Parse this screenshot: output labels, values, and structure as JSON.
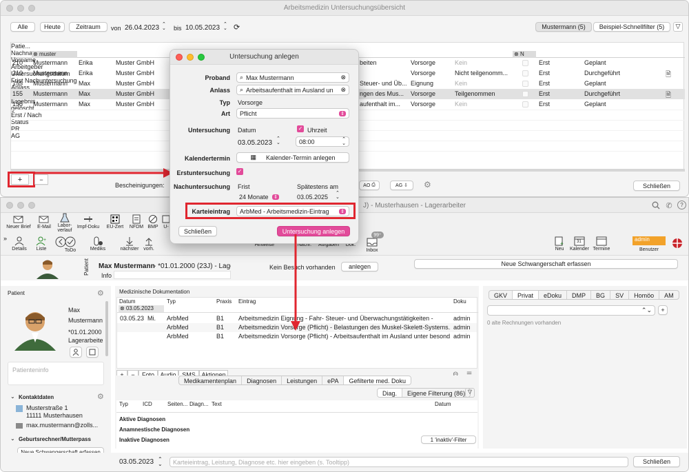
{
  "top_window": {
    "title": "Arbeitsmedizin Untersuchungsübersicht",
    "buttons": {
      "alle": "Alle",
      "heute": "Heute",
      "zeitraum": "Zeitraum",
      "von": "von",
      "von_date": "26.04.2023",
      "bis": "bis",
      "bis_date": "10.05.2023"
    },
    "filters": {
      "mustermann": "Mustermann (5)",
      "schnellfilter": "Beispiel-Schnellfilter (5)"
    },
    "columns": [
      "Patie...",
      "Nachname",
      "Vorname",
      "Arbeitgeber",
      "Untersuchungsdatum",
      "Frist Nachuntersuchung",
      "Anlass",
      "Typ",
      "Ergebnis",
      "gelöscht",
      "Erst / Nach",
      "Status",
      "PR",
      "AG"
    ],
    "filter_values": {
      "nachname": "muster",
      "geloescht": "N"
    },
    "rows": [
      {
        "id": "210",
        "nach": "Mustermann",
        "vor": "Erika",
        "ag": "Muster GmbH",
        "anlass": "beiten",
        "typ": "Vorsorge",
        "erg": "Kein",
        "en": "Erst",
        "status": "Geplant"
      },
      {
        "id": "210",
        "nach": "Mustermann",
        "vor": "Erika",
        "ag": "Muster GmbH",
        "anlass": "",
        "typ": "Vorsorge",
        "erg": "Nicht teilgenomm...",
        "en": "Erst",
        "status": "Durchgeführt"
      },
      {
        "id": "155",
        "nach": "Mustermann",
        "vor": "Max",
        "ag": "Muster GmbH",
        "anlass": "Steuer- und Üb...",
        "typ": "Eignung",
        "erg": "Kein",
        "en": "Erst",
        "status": "Geplant"
      },
      {
        "id": "155",
        "nach": "Mustermann",
        "vor": "Max",
        "ag": "Muster GmbH",
        "anlass": "ngen des Mus...",
        "typ": "Vorsorge",
        "erg": "Teilgenommen",
        "en": "Erst",
        "status": "Durchgeführt"
      },
      {
        "id": "155",
        "nach": "Mustermann",
        "vor": "Max",
        "ag": "Muster GmbH",
        "anlass": "aufenthalt im...",
        "typ": "Vorsorge",
        "erg": "Kein",
        "en": "Erst",
        "status": "Geplant"
      }
    ],
    "bottom": {
      "plus": "+",
      "minus": "−",
      "bescheinigungen": "Bescheinigungen:",
      "ao": "AO",
      "ag": "AG",
      "schliessen": "Schließen"
    }
  },
  "dialog": {
    "title": "Untersuchung anlegen",
    "proband_label": "Proband",
    "proband": "Max Mustermann",
    "anlass_label": "Anlass",
    "anlass": "Arbeitsaufenthalt im Ausland un",
    "typ_label": "Typ",
    "typ": "Vorsorge",
    "art_label": "Art",
    "art": "Pflicht",
    "untersuchung_label": "Untersuchung",
    "datum_label": "Datum",
    "uhrzeit_label": "Uhrzeit",
    "datum": "03.05.2023",
    "uhrzeit": "08:00",
    "kalender_label": "Kalendertermin",
    "kalender_btn": "Kalender-Termin anlegen",
    "erst_label": "Erstuntersuchung",
    "nach_label": "Nachuntersuchung",
    "frist_label": "Frist",
    "spaet_label": "Spätestens am",
    "frist": "24 Monate",
    "spaet": "03.05.2025",
    "kartei_label": "Karteieintrag",
    "kartei": "ArbMed - Arbeitsmedizin-Eintrag",
    "schliessen": "Schließen",
    "anlegen": "Untersuchung anlegen"
  },
  "main_window": {
    "title_suffix": "J) - Musterhausen - Lagerarbeiter",
    "toolbar": [
      {
        "label": "Neuer Brief",
        "icon": "letter-icon"
      },
      {
        "label": "E-Mail",
        "icon": "mail-icon"
      },
      {
        "label": "Labor-\nverlauf",
        "icon": "lab-icon"
      },
      {
        "label": "Impf-Doku",
        "icon": "syringe-icon"
      },
      {
        "label": "EU-Zert",
        "icon": "qr-icon"
      },
      {
        "label": "NFDM",
        "icon": "doc-icon"
      },
      {
        "label": "BMP",
        "icon": "pill-icon"
      },
      {
        "label": "U-",
        "icon": "u-icon"
      }
    ],
    "toolbar2": [
      {
        "label": "Details"
      },
      {
        "label": "Liste"
      },
      {
        "label": "ToDo"
      },
      {
        "label": "Mediks"
      },
      {
        "label": "nächster"
      },
      {
        "label": "vorh."
      }
    ],
    "toolbar3": [
      {
        "label": "Hinweise"
      },
      {
        "label": "Nachr."
      },
      {
        "label": "Aufgaben"
      },
      {
        "label": "Dok."
      },
      {
        "label": "Inbox"
      }
    ],
    "inbox_badge": "99⁺",
    "right_tools": [
      {
        "label": "Neu"
      },
      {
        "label": "Kalender"
      },
      {
        "label": "Termine"
      }
    ],
    "calendar_day": "31",
    "benutzer_label": "Benutzer",
    "benutzer": "admin",
    "patient_header": {
      "name": "Max Mustermann",
      "info": "- *01.01.2000 (23J) - Lagera",
      "info_label": "Info",
      "patient_tab": "Patient",
      "kein_besuch": "Kein Besuch vorhanden",
      "anlegen": "anlegen",
      "schwanger": "Neue Schwangerschaft erfassen"
    },
    "patient_panel": {
      "title": "Patient",
      "vorname": "Max",
      "nachname": "Mustermann",
      "geb": "*01.01.2000",
      "beruf": "Lagerarbeite",
      "patienteninfo": "Patienteninfo"
    },
    "kontakt": {
      "title": "Kontaktdaten",
      "strasse": "Musterstraße 1",
      "ort": "11111 Musterhausen",
      "email": "max.mustermann@zolls..."
    },
    "geburt": {
      "title": "Geburtsrechner/Mutterpass",
      "btn": "Neue Schwangerschaft erfassen"
    },
    "med_doku": {
      "title": "Medizinische Dokumentation",
      "cols": [
        "Datum",
        "Typ",
        "Praxis",
        "Eintrag",
        "Doku"
      ],
      "filter_date": "03.05.2023",
      "rows": [
        {
          "datum": "03.05.23",
          "tag": "Mi.",
          "typ": "ArbMed",
          "praxis": "B1",
          "eintrag": "Arbeitsmedizin Eignung - Fahr- Steuer- und Überwachungstätigkeiten -",
          "doku": "admin"
        },
        {
          "datum": "",
          "tag": "",
          "typ": "ArbMed",
          "praxis": "B1",
          "eintrag": "Arbeitsmedizin Vorsorge (Pflicht) - Belastungen des Muskel-Skelett-Systems...",
          "doku": "admin"
        },
        {
          "datum": "",
          "tag": "",
          "typ": "ArbMed",
          "praxis": "B1",
          "eintrag": "Arbeitsmedizin Vorsorge (Pflicht) - Arbeitsaufenthalt im Ausland unter besond...",
          "doku": "admin"
        }
      ],
      "tools": [
        "+",
        "−",
        "Foto",
        "Audio",
        "SMS",
        "Aktionen"
      ]
    },
    "tabs": [
      "Medikamentenplan",
      "Diagnosen",
      "Leistungen",
      "ePA",
      "Gefilterte med. Doku"
    ],
    "diag": {
      "btn": "Diag.",
      "filter": "Eigene Filterung (86)",
      "cols": [
        "Typ",
        "ICD",
        "Seiten...",
        "Diagn...",
        "Text",
        "Datum"
      ],
      "aktive": "Aktive Diagnosen",
      "anam": "Anamnestische Diagnosen",
      "inaktive": "Inaktive Diagnosen",
      "inaktiv_filter": "1 'inaktiv'-Filter"
    },
    "billing_tabs": [
      "GKV",
      "Privat",
      "eDoku",
      "DMP",
      "BG",
      "SV",
      "Homöo",
      "AM"
    ],
    "billing_empty": "0 alte Rechnungen vorhanden",
    "footer": {
      "date": "03.05.2023",
      "placeholder": "Karteieintrag, Leistung, Diagnose etc. hier eingeben (s. Tooltipp)",
      "schliessen": "Schließen"
    }
  },
  "colors": {
    "highlight_red": "#e0262f",
    "pink": "#e24b9a",
    "selection": "#e1e1e1",
    "admin_orange": "#f2a22a"
  }
}
